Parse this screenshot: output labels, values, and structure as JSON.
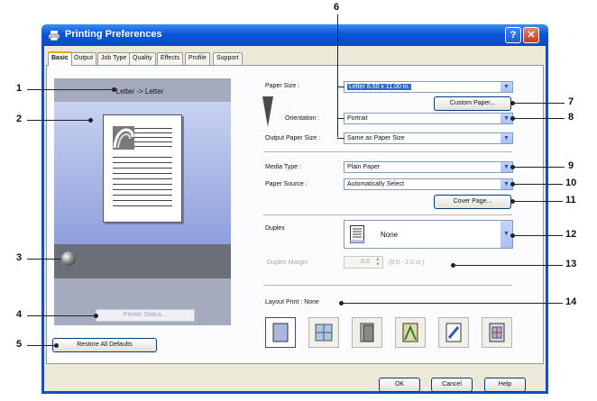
{
  "window": {
    "title": "Printing Preferences"
  },
  "title_buttons": {
    "help": "?",
    "close": "✕"
  },
  "tabs": [
    "Basic",
    "Output",
    "Job Type",
    "Quality",
    "Effects",
    "Profile",
    "Support"
  ],
  "preview": {
    "label": "Letter -> Letter",
    "printer_status": "Printer Status..."
  },
  "restore_button": "Restore All Defaults",
  "paper_size": {
    "label": "Paper Size :",
    "value": "Letter  8.50 x 11.00 in."
  },
  "custom_paper_button": "Custom Paper...",
  "orientation": {
    "label": "Orientation :",
    "value": "Portrait"
  },
  "output_paper_size": {
    "label": "Output Paper Size :",
    "value": "Same as Paper Size"
  },
  "media_type": {
    "label": "Media Type :",
    "value": "Plain Paper"
  },
  "paper_source": {
    "label": "Paper Source :",
    "value": "Automatically Select"
  },
  "cover_page_button": "Cover Page...",
  "duplex": {
    "label": "Duplex",
    "value": "None"
  },
  "duplex_margin": {
    "label": "Duplex Margin",
    "value": "0.0",
    "range": "(0.0 - 2.0 in.)"
  },
  "layout_print": {
    "label": "Layout Print :",
    "value": "None"
  },
  "dialog_buttons": {
    "ok": "OK",
    "cancel": "Cancel",
    "help": "Help"
  },
  "callouts": [
    "1",
    "2",
    "3",
    "4",
    "5",
    "6",
    "7",
    "8",
    "9",
    "10",
    "11",
    "12",
    "13",
    "14"
  ],
  "colors": {
    "title_bar": "#0a57d8",
    "panel_bg": "#fcfcfe",
    "preview_bg": "#a4abbe",
    "selection": "#316ac5"
  },
  "icons": [
    "printer-icon",
    "document-preview-icon",
    "status-ball-icon",
    "layout-single-icon",
    "layout-n-up-icon",
    "layout-booklet-icon",
    "layout-poster-icon",
    "layout-watermark-icon",
    "layout-overlay-icon"
  ]
}
